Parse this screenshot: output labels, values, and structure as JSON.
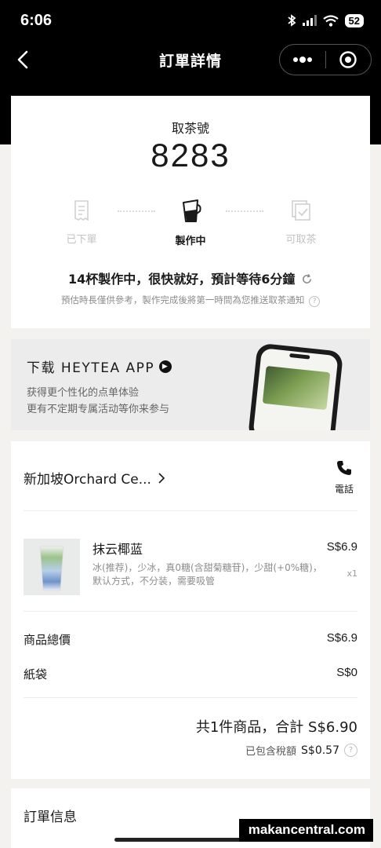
{
  "status_bar": {
    "time": "6:06",
    "battery": "52"
  },
  "nav": {
    "title": "訂單詳情",
    "more_icon": "more-dots-icon",
    "close_icon": "target-circle-icon"
  },
  "pickup": {
    "label": "取茶號",
    "number": "8283",
    "steps": [
      {
        "label": "已下單",
        "icon": "receipt-icon",
        "state": "done"
      },
      {
        "label": "製作中",
        "icon": "shaker-cup-icon",
        "state": "active"
      },
      {
        "label": "可取茶",
        "icon": "cup-check-icon",
        "state": "pending"
      }
    ],
    "status_text": "14杯製作中，很快就好，預計等待6分鐘",
    "note": "預估時長僅供參考，製作完成後將第一時間為您推送取茶通知",
    "help_glyph": "?"
  },
  "banner": {
    "title": "下载 HEYTEA APP",
    "line1": "获得更个性化的点单体验",
    "line2": "更有不定期专属活动等你来参与"
  },
  "order": {
    "store": "新加坡Orchard Ce...",
    "phone_label": "電話",
    "item": {
      "name": "抹云椰蓝",
      "options": "冰(推荐)，少冰，真0糖(含甜菊糖苷)，少甜(+0%糖)，默认方式，不分装，需要吸管",
      "price": "S$6.9",
      "qty": "x1"
    },
    "rows": [
      {
        "label": "商品總價",
        "value": "S$6.9"
      },
      {
        "label": "紙袋",
        "value": "S$0"
      }
    ],
    "total": "共1件商品，合計 S$6.90",
    "tax_label": "已包含稅額",
    "tax_value": "S$0.57",
    "tax_help": "?"
  },
  "info": {
    "title": "訂單信息"
  },
  "watermark": "makancentral.com"
}
